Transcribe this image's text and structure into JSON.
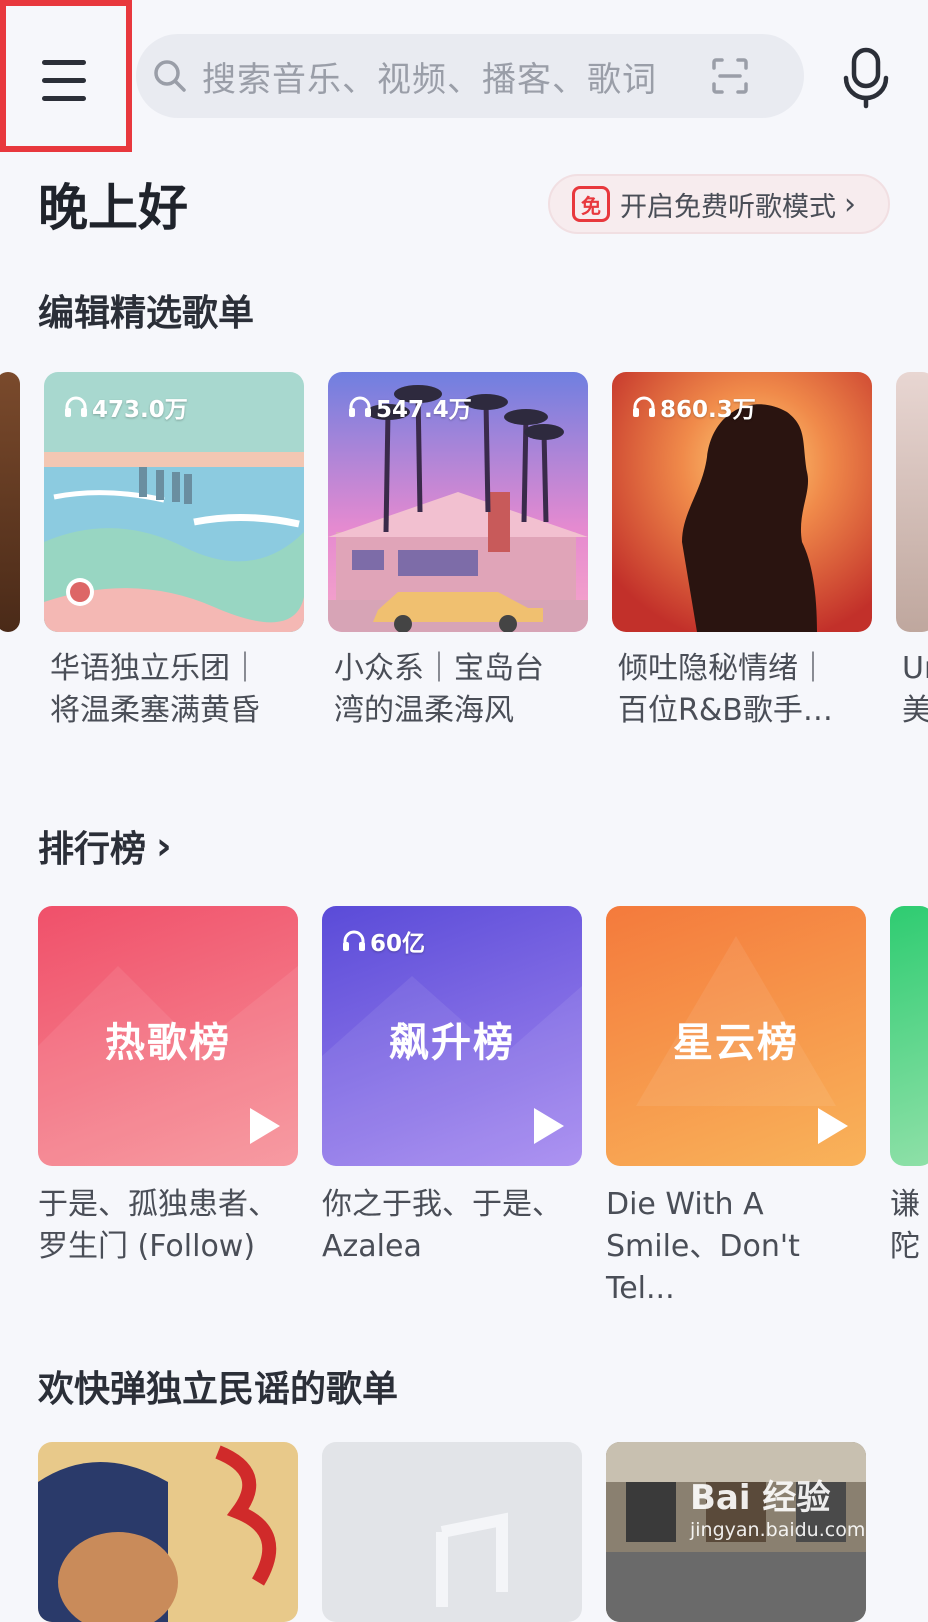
{
  "header": {
    "search_placeholder": "搜索音乐、视频、播客、歌词"
  },
  "greeting": "晚上好",
  "free_mode": {
    "badge": "免",
    "label": "开启免费听歌模式"
  },
  "editor_picks": {
    "title": "编辑精选歌单",
    "items": [
      {
        "plays": "473.0万",
        "line1": "华语独立乐团｜",
        "line2": "将温柔塞满黄昏"
      },
      {
        "plays": "547.4万",
        "line1": "小众系｜宝岛台",
        "line2": "湾的温柔海风"
      },
      {
        "plays": "860.3万",
        "line1": "倾吐隐秘情绪｜",
        "line2": "百位R&B歌手…"
      }
    ],
    "partial_right": {
      "line1": "Ur",
      "line2": "美"
    }
  },
  "charts": {
    "title": "排行榜",
    "items": [
      {
        "name": "热歌榜",
        "plays": "",
        "line1": "于是、孤独患者、",
        "line2": "罗生门 (Follow)"
      },
      {
        "name": "飙升榜",
        "plays": "60亿",
        "line1": "你之于我、于是、",
        "line2": "Azalea"
      },
      {
        "name": "星云榜",
        "plays": "",
        "line1": "Die With A",
        "line2": "Smile、Don't Tel..."
      }
    ],
    "partial_right": {
      "line1": "谦",
      "line2": "陀"
    }
  },
  "folk": {
    "title": "欢快弹独立民谣的歌单"
  },
  "watermark": {
    "brand": "Bai 经验",
    "url": "jingyan.baidu.com"
  },
  "colors": {
    "accent": "#e8383d",
    "background": "#f6f7fb"
  }
}
